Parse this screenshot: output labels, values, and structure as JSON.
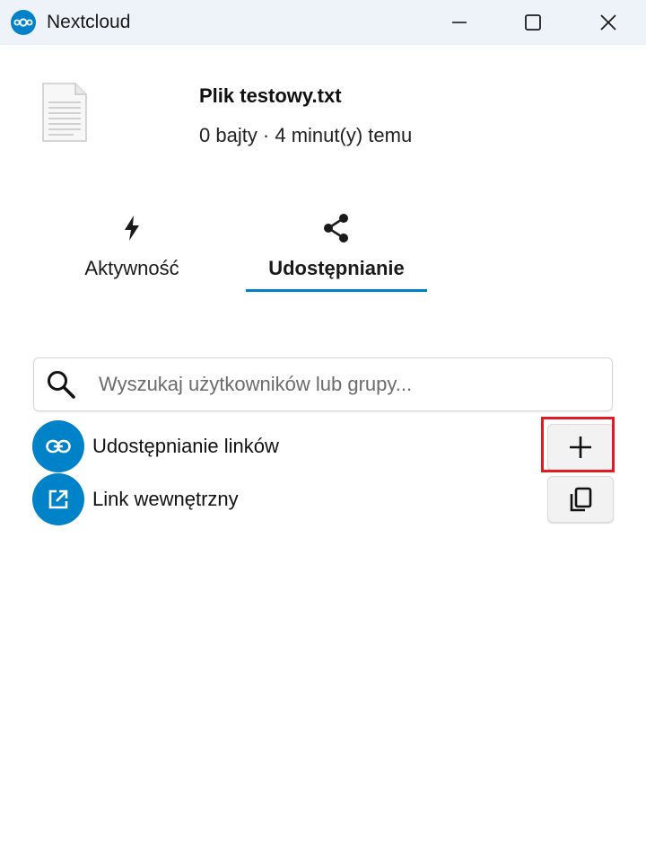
{
  "window": {
    "title": "Nextcloud",
    "icons": {
      "logo": "nextcloud-logo-icon",
      "minimize": "minimize-icon",
      "maximize": "maximize-icon",
      "close": "close-icon"
    }
  },
  "file": {
    "name": "Plik testowy.txt",
    "meta": "0 bajty · 4 minut(y) temu",
    "icon": "text-file-icon"
  },
  "tabs": [
    {
      "label": "Aktywność",
      "icon": "lightning-icon",
      "active": false
    },
    {
      "label": "Udostępnianie",
      "icon": "share-icon",
      "active": true
    }
  ],
  "search": {
    "placeholder": "Wyszukaj użytkowników lub grupy...",
    "value": "",
    "icon": "search-icon"
  },
  "shares": [
    {
      "label": "Udostępnianie linków",
      "icon": "link-icon",
      "action": "add-icon"
    },
    {
      "label": "Link wewnętrzny",
      "icon": "external-link-icon",
      "action": "copy-icon"
    }
  ],
  "colors": {
    "accent": "#0082c9",
    "titlebar": "#eef3fa",
    "highlight": "#e01b24"
  }
}
